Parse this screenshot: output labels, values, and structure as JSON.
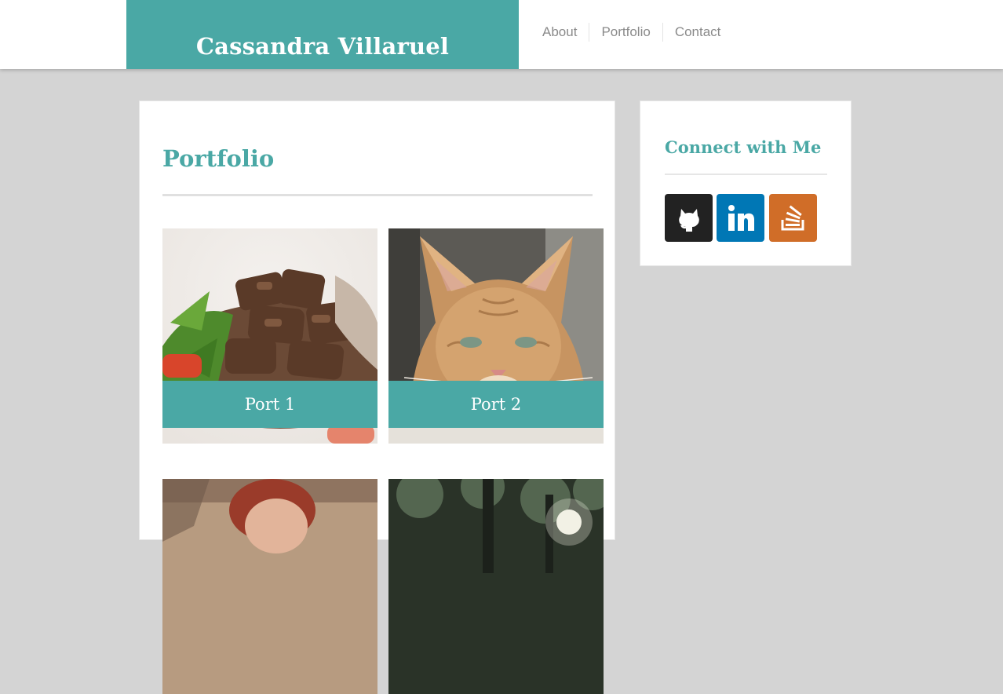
{
  "header": {
    "site_title": "Cassandra Villaruel",
    "brand_color": "#4aa8a5",
    "nav": [
      {
        "label": "About"
      },
      {
        "label": "Portfolio"
      },
      {
        "label": "Contact"
      }
    ]
  },
  "main": {
    "heading": "Portfolio",
    "tiles": [
      {
        "caption": "Port 1",
        "image": "salad-with-beef-photo"
      },
      {
        "caption": "Port 2",
        "image": "orange-tabby-cat-photo"
      },
      {
        "caption": "",
        "image": "woman-portrait-photo"
      },
      {
        "caption": "",
        "image": "tree-canopy-photo"
      }
    ]
  },
  "sidebar": {
    "heading": "Connect with Me",
    "links": [
      {
        "icon": "github-icon",
        "color": "#222222"
      },
      {
        "icon": "linkedin-icon",
        "color": "#0077b5"
      },
      {
        "icon": "stackoverflow-icon",
        "color": "#d06d28"
      }
    ]
  }
}
